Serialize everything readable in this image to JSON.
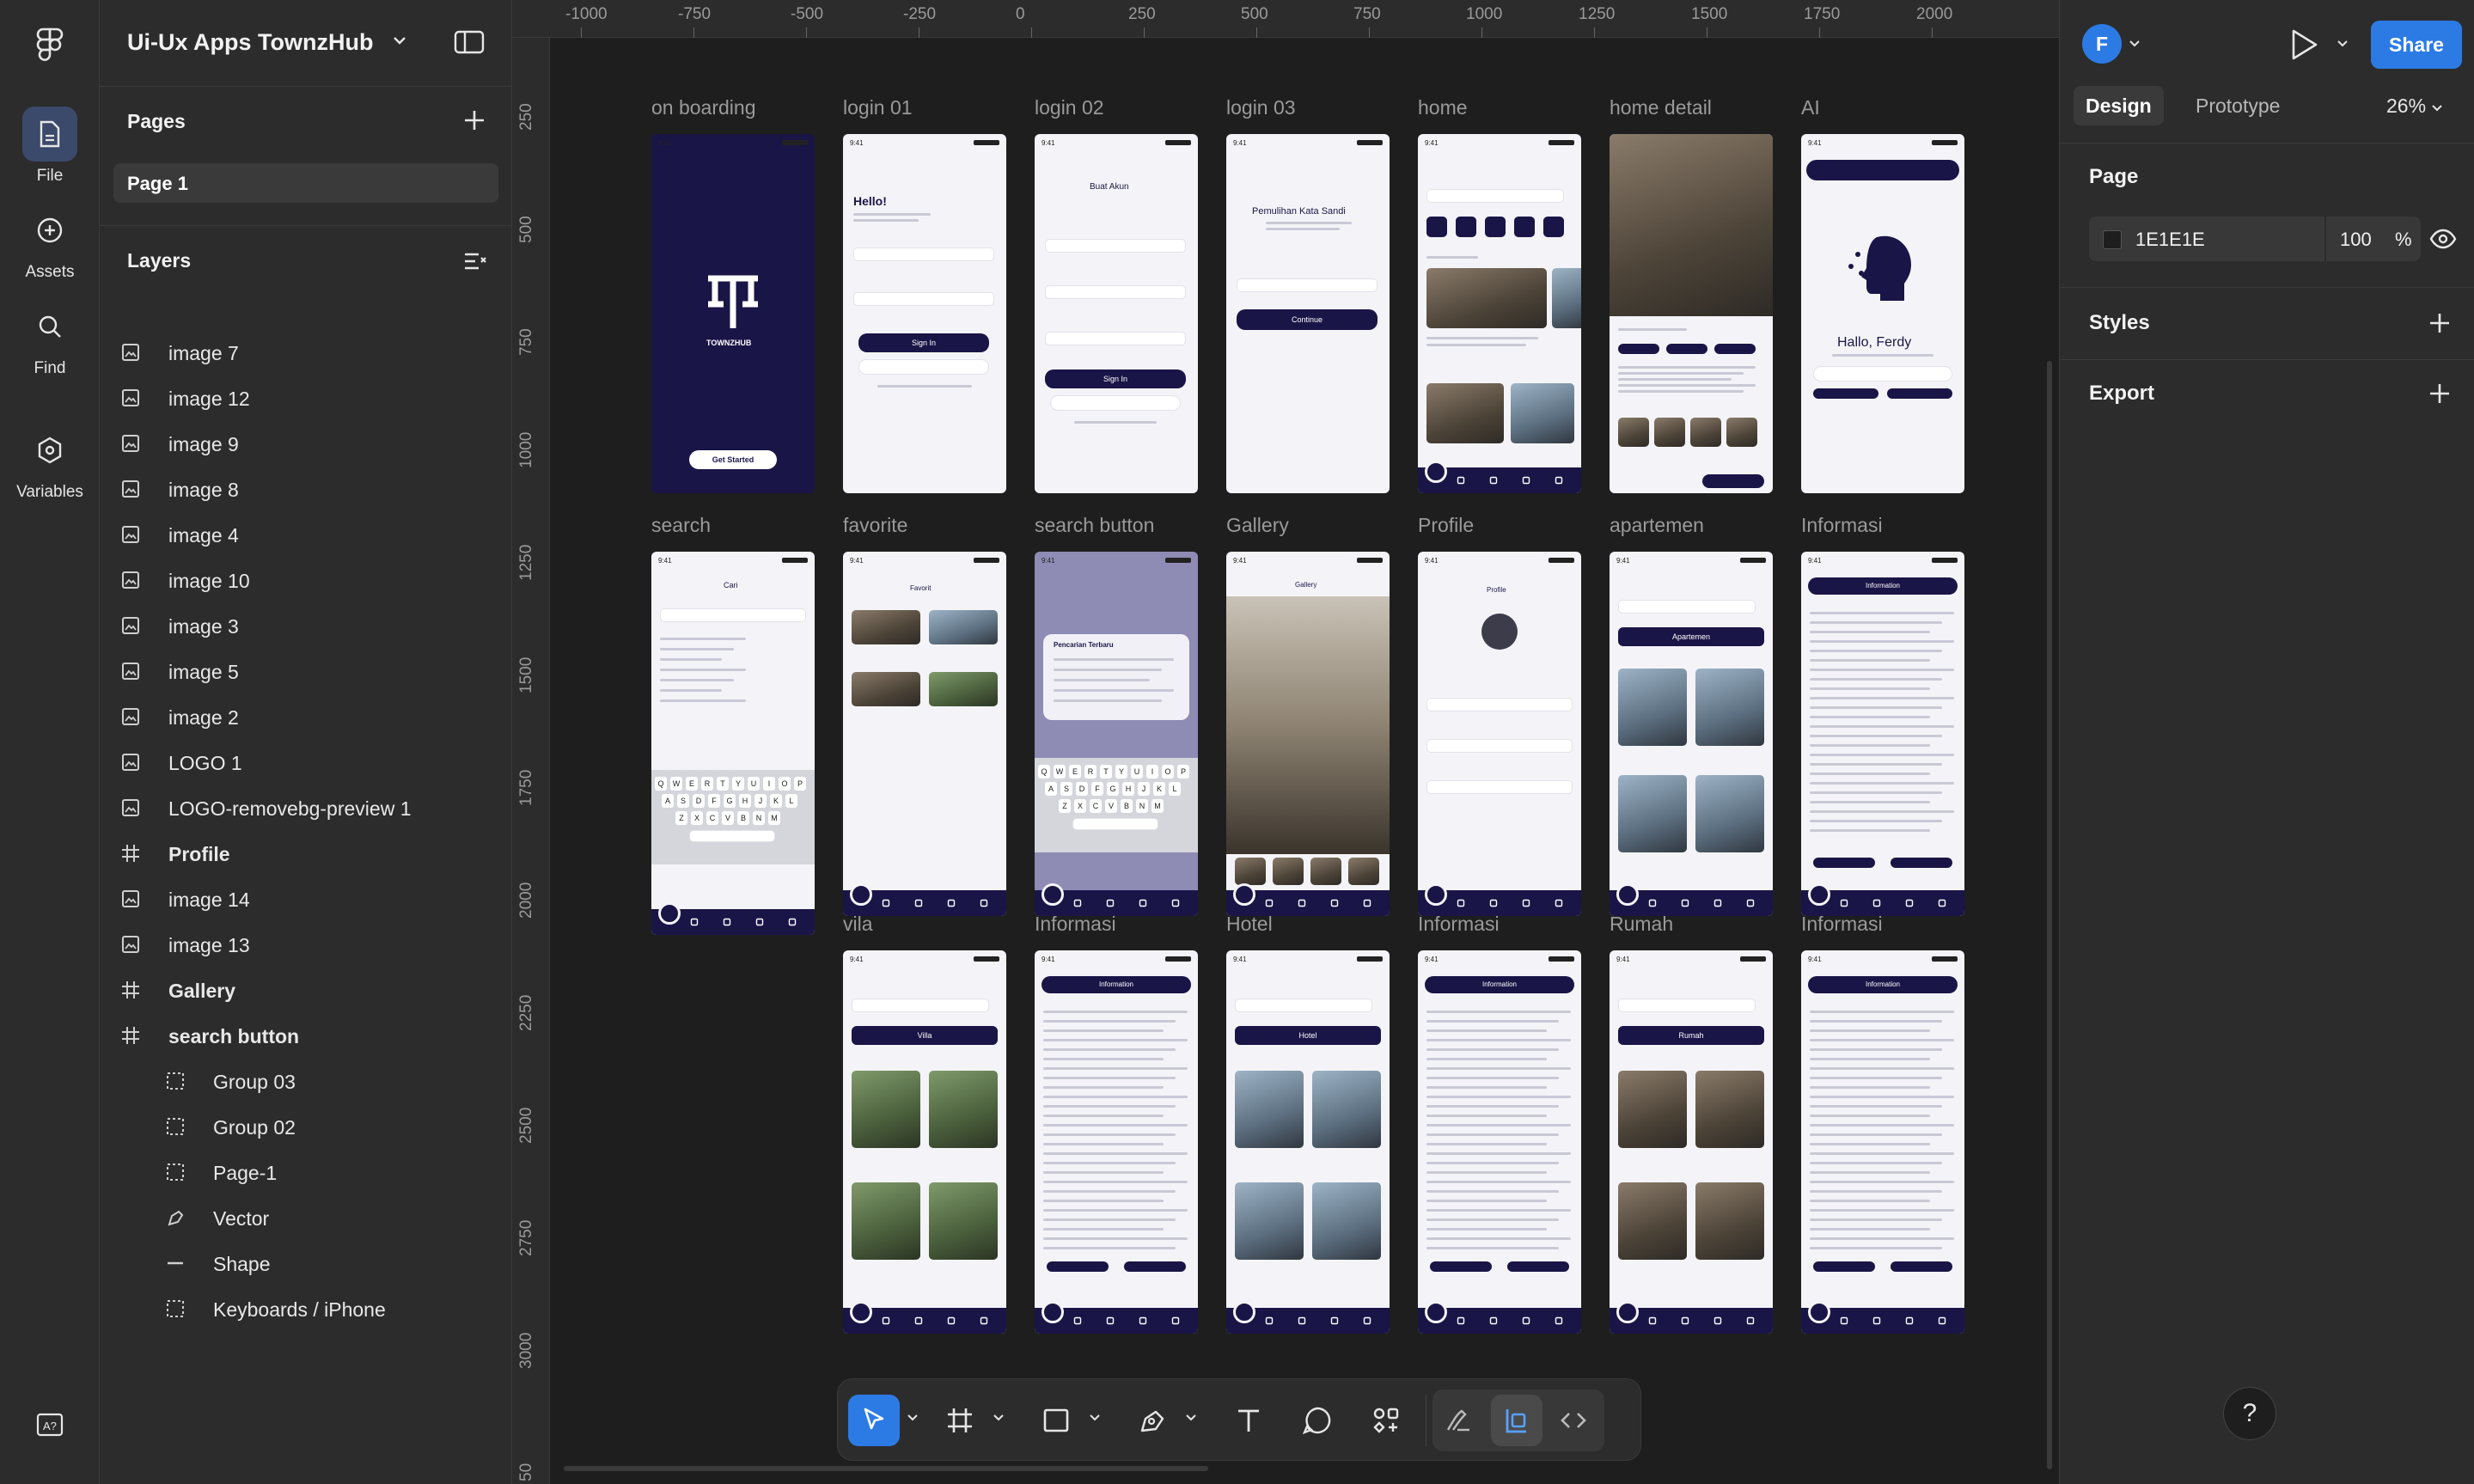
{
  "rail": {
    "items": [
      {
        "label": "File",
        "icon": "file-icon"
      },
      {
        "label": "Assets",
        "icon": "assets-icon"
      },
      {
        "label": "Find",
        "icon": "search-icon"
      },
      {
        "label": "Variables",
        "icon": "variables-icon"
      }
    ]
  },
  "project": {
    "title": "Ui-Ux Apps TownzHub"
  },
  "pages": {
    "heading": "Pages",
    "items": [
      "Page 1"
    ]
  },
  "layers": {
    "heading": "Layers",
    "items": [
      {
        "name": "image 7",
        "kind": "image"
      },
      {
        "name": "image 12",
        "kind": "image"
      },
      {
        "name": "image 9",
        "kind": "image"
      },
      {
        "name": "image 8",
        "kind": "image"
      },
      {
        "name": "image 4",
        "kind": "image"
      },
      {
        "name": "image 10",
        "kind": "image"
      },
      {
        "name": "image 3",
        "kind": "image"
      },
      {
        "name": "image 5",
        "kind": "image"
      },
      {
        "name": "image 2",
        "kind": "image"
      },
      {
        "name": "LOGO 1",
        "kind": "image"
      },
      {
        "name": "LOGO-removebg-preview 1",
        "kind": "image"
      },
      {
        "name": "Profile",
        "kind": "frame"
      },
      {
        "name": "image 14",
        "kind": "image"
      },
      {
        "name": "image 13",
        "kind": "image"
      },
      {
        "name": "Gallery",
        "kind": "frame"
      },
      {
        "name": "search button",
        "kind": "frame"
      },
      {
        "name": "Group 03",
        "kind": "group"
      },
      {
        "name": "Group 02",
        "kind": "group"
      },
      {
        "name": "Page-1",
        "kind": "group"
      },
      {
        "name": "Vector",
        "kind": "vector"
      },
      {
        "name": "Shape",
        "kind": "shape"
      },
      {
        "name": "Keyboards / iPhone",
        "kind": "group"
      }
    ]
  },
  "ruler": {
    "top": [
      "-1000",
      "-750",
      "-500",
      "-250",
      "0",
      "250",
      "500",
      "750",
      "1000",
      "1250",
      "1500",
      "1750",
      "2000"
    ],
    "left": [
      "250",
      "500",
      "750",
      "1000",
      "1250",
      "1500",
      "1750",
      "2000",
      "2250",
      "2500",
      "2750",
      "3000",
      "50"
    ]
  },
  "frames": {
    "row1": [
      "on boarding",
      "login 01",
      "login 02",
      "login 03",
      "home",
      "home detail",
      "AI"
    ],
    "row2": [
      "search",
      "favorite",
      "search button",
      "Gallery",
      "Profile",
      "apartemen",
      "Informasi"
    ],
    "row3": [
      "vila",
      "Informasi",
      "Hotel",
      "Informasi",
      "Rumah",
      "Informasi"
    ]
  },
  "phone_text": {
    "brand": "TOWNZHUB",
    "get_started": "Get Started",
    "hello": "Hello!",
    "buat_akun": "Buat Akun",
    "pemulihan": "Pemulihan Kata Sandi",
    "sign_in": "Sign In",
    "continue": "Continue",
    "hallo": "Hallo, Ferdy",
    "cari": "Cari",
    "favorit": "Favorit",
    "gallery": "Gallery",
    "profile": "Profile",
    "information": "Information",
    "apartemen": "Apartemen",
    "villa": "Villa",
    "hotel": "Hotel",
    "rumah": "Rumah",
    "pencarian": "Pencarian Terbaru",
    "kbd_row1": [
      "Q",
      "W",
      "E",
      "R",
      "T",
      "Y",
      "U",
      "I",
      "O",
      "P"
    ],
    "kbd_row2": [
      "A",
      "S",
      "D",
      "F",
      "G",
      "H",
      "J",
      "K",
      "L"
    ],
    "kbd_row3": [
      "Z",
      "X",
      "C",
      "V",
      "B",
      "N",
      "M"
    ]
  },
  "toolbar": {
    "tools": [
      "move-tool",
      "frame-tool",
      "rectangle-tool",
      "pen-tool",
      "text-tool",
      "comment-tool",
      "components-tool"
    ],
    "modes": [
      "draw-mode",
      "design-mode",
      "dev-mode"
    ]
  },
  "right": {
    "avatar": "F",
    "share": "Share",
    "tabs": [
      "Design",
      "Prototype"
    ],
    "zoom": "26%",
    "page_heading": "Page",
    "fill_hex": "1E1E1E",
    "fill_opacity": "100",
    "fill_pct": "%",
    "styles": "Styles",
    "export": "Export",
    "help": "?"
  },
  "colors": {
    "accent": "#2c7be5",
    "brand_navy": "#1a1547",
    "canvas": "#1e1e1e",
    "panel": "#2c2c2c"
  }
}
